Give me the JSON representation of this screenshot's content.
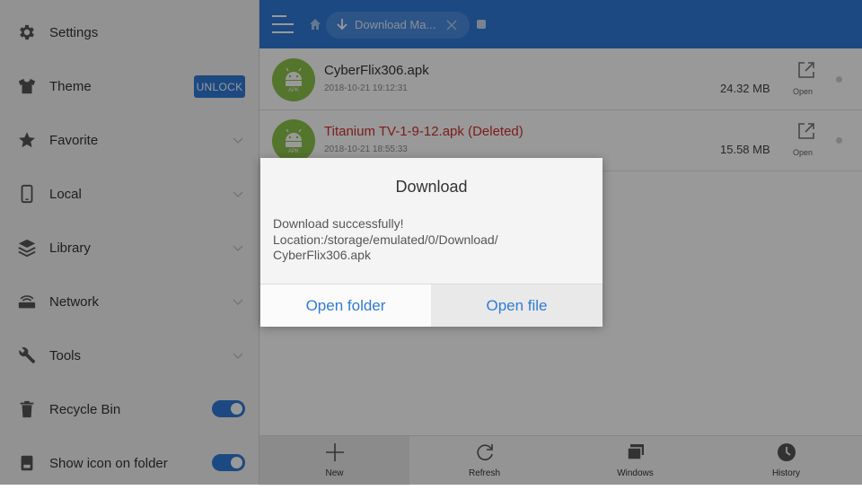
{
  "sidebar": {
    "items": [
      {
        "label": "Settings",
        "icon": "gear-icon"
      },
      {
        "label": "Theme",
        "icon": "shirt-icon",
        "badge": "UNLOCK"
      },
      {
        "label": "Favorite",
        "icon": "star-icon"
      },
      {
        "label": "Local",
        "icon": "phone-icon"
      },
      {
        "label": "Library",
        "icon": "layers-icon"
      },
      {
        "label": "Network",
        "icon": "router-icon"
      },
      {
        "label": "Tools",
        "icon": "wrench-icon"
      },
      {
        "label": "Recycle Bin",
        "icon": "trash-icon",
        "toggle": "on"
      },
      {
        "label": "Show icon on folder",
        "icon": "folder-icon",
        "toggle": "on"
      }
    ]
  },
  "topbar": {
    "tab_label": "Download Ma...",
    "accent": "#2f7bd8"
  },
  "files": [
    {
      "name": "CyberFlix306.apk",
      "date": "2018-10-21 19:12:31",
      "size": "24.32 MB",
      "action": "Open",
      "icon_text": "APK"
    },
    {
      "name": "Titanium TV-1-9-12.apk  (Deleted)",
      "date": "2018-10-21 18:55:33",
      "size": "15.58 MB",
      "action": "Open",
      "icon_text": "APK"
    }
  ],
  "bottombar": {
    "items": [
      {
        "label": "New",
        "icon": "plus-icon"
      },
      {
        "label": "Refresh",
        "icon": "refresh-icon"
      },
      {
        "label": "Windows",
        "icon": "windows-icon"
      },
      {
        "label": "History",
        "icon": "clock-icon"
      }
    ]
  },
  "dialog": {
    "title": "Download",
    "message_line1": "Download  successfully!",
    "message_line2": "Location:/storage/emulated/0/Download/",
    "message_line3": "CyberFlix306.apk",
    "btn_open_folder": "Open folder",
    "btn_open_file": "Open file"
  }
}
